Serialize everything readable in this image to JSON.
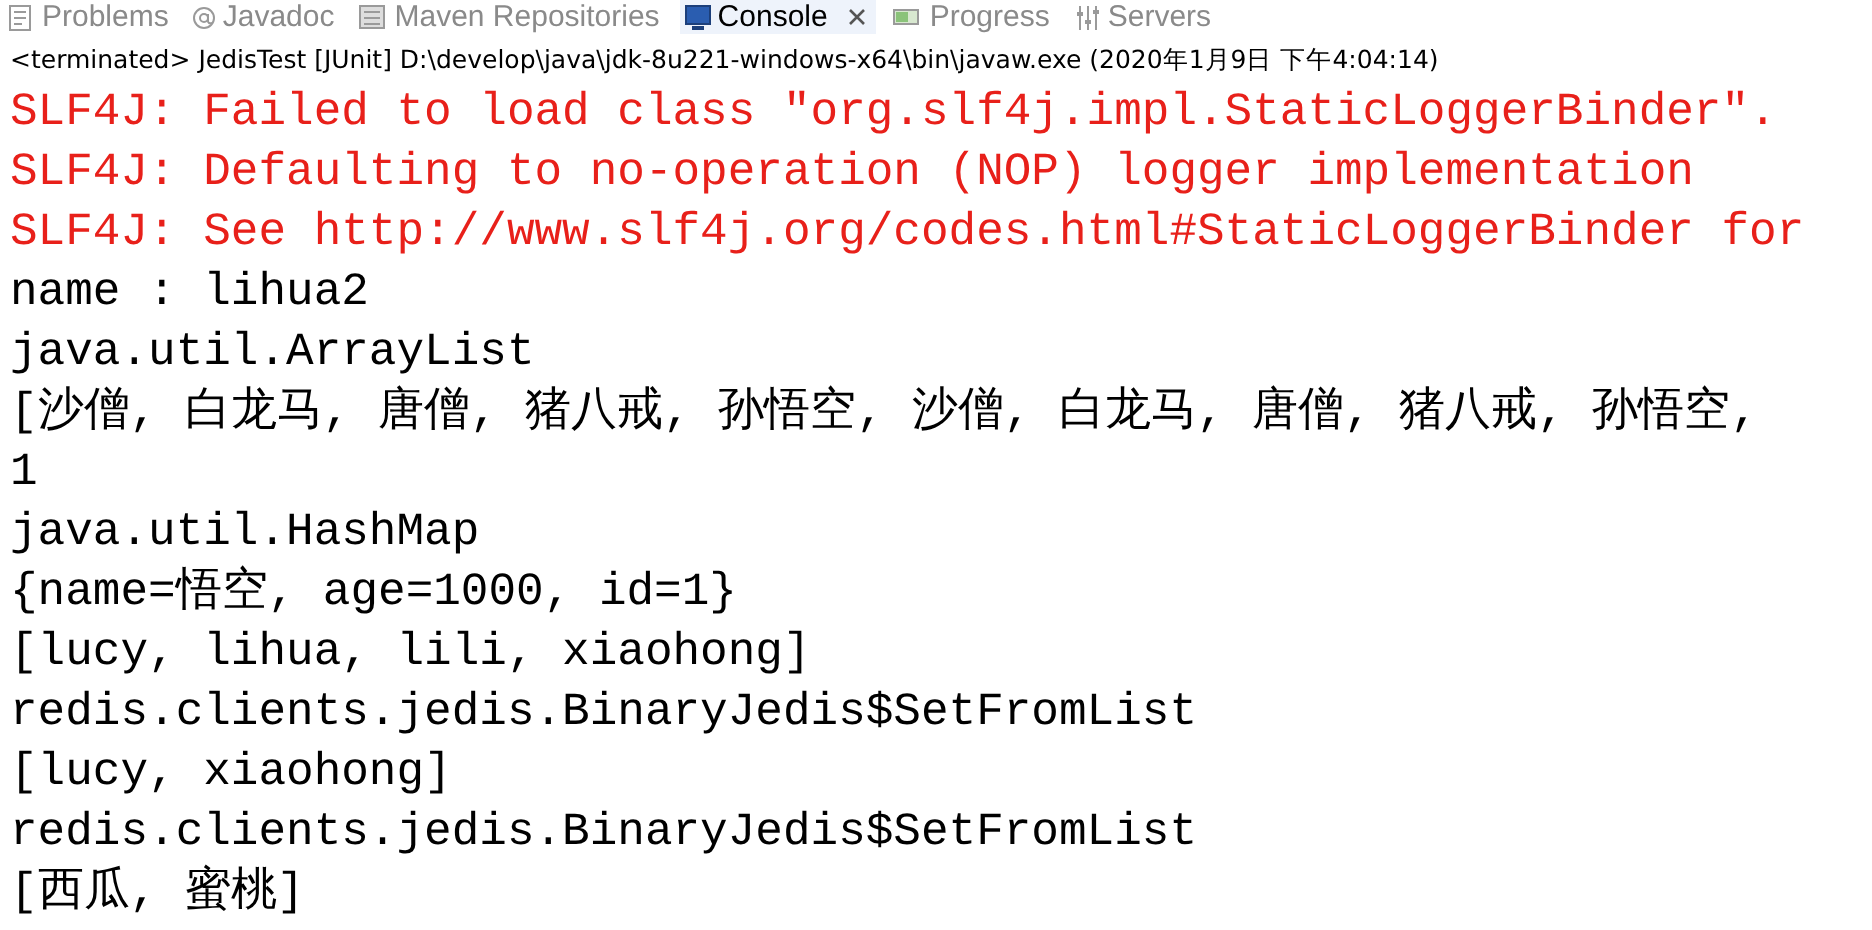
{
  "tabs": [
    {
      "label": "Problems",
      "selected": false
    },
    {
      "label": "Javadoc",
      "selected": false
    },
    {
      "label": "Maven Repositories",
      "selected": false
    },
    {
      "label": "Console",
      "selected": true
    },
    {
      "label": "Progress",
      "selected": false
    },
    {
      "label": "Servers",
      "selected": false
    }
  ],
  "status": "<terminated> JedisTest [JUnit] D:\\develop\\java\\jdk-8u221-windows-x64\\bin\\javaw.exe (2020年1月9日 下午4:04:14)",
  "lines": [
    {
      "kind": "error",
      "text": "SLF4J: Failed to load class \"org.slf4j.impl.StaticLoggerBinder\"."
    },
    {
      "kind": "error",
      "text": "SLF4J: Defaulting to no-operation (NOP) logger implementation"
    },
    {
      "kind": "error",
      "text": "SLF4J: See http://www.slf4j.org/codes.html#StaticLoggerBinder for"
    },
    {
      "kind": "output",
      "text": "name : lihua2"
    },
    {
      "kind": "output",
      "text": "java.util.ArrayList"
    },
    {
      "kind": "output",
      "text": "[沙僧, 白龙马, 唐僧, 猪八戒, 孙悟空, 沙僧, 白龙马, 唐僧, 猪八戒, 孙悟空,"
    },
    {
      "kind": "output",
      "text": "1"
    },
    {
      "kind": "output",
      "text": "java.util.HashMap"
    },
    {
      "kind": "output",
      "text": "{name=悟空, age=1000, id=1}"
    },
    {
      "kind": "output",
      "text": "[lucy, lihua, lili, xiaohong]"
    },
    {
      "kind": "output",
      "text": "redis.clients.jedis.BinaryJedis$SetFromList"
    },
    {
      "kind": "output",
      "text": "[lucy, xiaohong]"
    },
    {
      "kind": "output",
      "text": "redis.clients.jedis.BinaryJedis$SetFromList"
    },
    {
      "kind": "output",
      "text": "[西瓜, 蜜桃]"
    }
  ]
}
